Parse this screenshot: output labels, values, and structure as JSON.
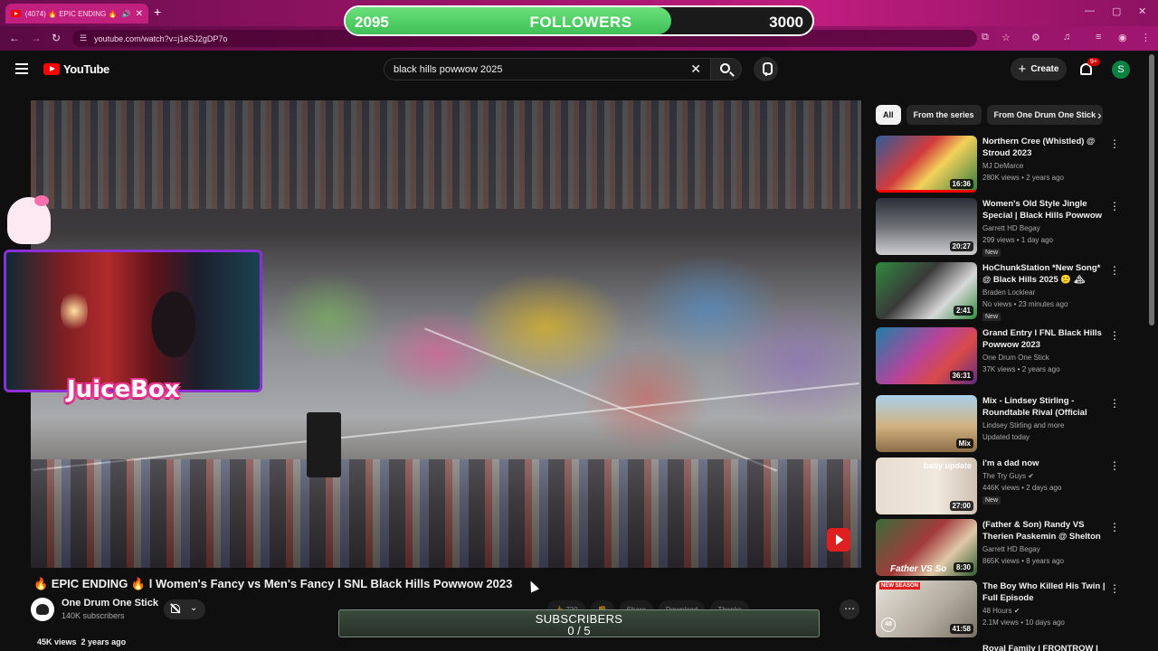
{
  "browser": {
    "tab_title": "(4074) 🔥 EPIC ENDING 🔥",
    "url": "youtube.com/watch?v=j1eSJ2gDP7o"
  },
  "followers_goal": {
    "current": "2095",
    "label": "FOLLOWERS",
    "goal": "3000",
    "progress": 0.698
  },
  "masthead": {
    "logo_text": "YouTube",
    "search_query": "black hills powwow 2025",
    "create_label": "Create",
    "notif_badge": "9+",
    "avatar_letter": "S"
  },
  "stream_overlay": {
    "brand": "JuiceBox"
  },
  "video": {
    "title": "🔥 EPIC ENDING 🔥 l Women's Fancy vs Men's Fancy l SNL Black Hills Powwow 2023",
    "channel": "One Drum One Stick",
    "subscribers": "140K subscribers",
    "views": "45K views",
    "age": "2 years ago",
    "actions": [
      "720",
      "",
      "Share",
      "Download",
      "Thanks"
    ]
  },
  "subscribers_goal": {
    "label": "SUBSCRIBERS",
    "count": "0 / 5"
  },
  "chips": [
    "All",
    "From the series",
    "From One Drum One Stick"
  ],
  "recommendations": [
    {
      "title": "Northern Cree (Whistled) @ Stroud 2023",
      "channel": "MJ DeMarce",
      "meta": "280K views • 2 years ago",
      "duration": "16:36",
      "new": ""
    },
    {
      "title": "Women's Old Style Jingle Special | Black Hills Powwow ...",
      "channel": "Garrett HD Begay",
      "meta": "299 views • 1 day ago",
      "duration": "20:27",
      "new": "New"
    },
    {
      "title": "HoChunkStation *New Song* @ Black Hills 2025 🙂 🏔",
      "channel": "Braden Locklear",
      "meta": "No views • 23 minutes ago",
      "duration": "2:41",
      "new": "New"
    },
    {
      "title": "Grand Entry l FNL Black Hills Powwow 2023",
      "channel": "One Drum One Stick",
      "meta": "37K views • 2 years ago",
      "duration": "36:31",
      "new": ""
    },
    {
      "title": "Mix - Lindsey Stirling - Roundtable Rival (Official Musi...",
      "channel": "Lindsey Stirling and more",
      "meta": "Updated today",
      "duration": "Mix",
      "new": ""
    },
    {
      "title": "i'm a dad now",
      "channel": "The Try Guys",
      "meta": "446K views • 2 days ago",
      "duration": "27:00",
      "new": "New"
    },
    {
      "title": "(Father & Son) Randy VS Therien Paskemin @ Shelton ...",
      "channel": "Garrett HD Begay",
      "meta": "865K views • 8 years ago",
      "duration": "8:30",
      "new": ""
    },
    {
      "title": "The Boy Who Killed His Twin | Full Episode",
      "channel": "48 Hours",
      "meta": "2.1M views • 10 days ago",
      "duration": "41:58",
      "new": ""
    }
  ],
  "rec_thumb_text": {
    "baby_update": "baby update",
    "father_vs_son": "Father VS So",
    "new_season": "NEW SEASON",
    "channel_48": "48"
  },
  "rec_partial": "Royal Family | FRONTROW I"
}
